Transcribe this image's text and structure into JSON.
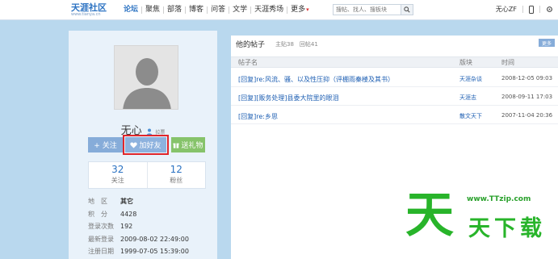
{
  "header": {
    "logo_text": "天涯社区",
    "logo_url": "www.tianya.cn",
    "nav": [
      "论坛",
      "聚焦",
      "部落",
      "博客",
      "问答",
      "文学",
      "天涯秀场",
      "更多"
    ],
    "search_placeholder": "搜帖、找人、搜板块",
    "user_name": "无心ZF"
  },
  "profile": {
    "name": "无心",
    "name_tag": "拉票",
    "buttons": {
      "follow": "+ 关注",
      "add_friend": "加好友",
      "gift": "送礼物"
    },
    "stats": [
      {
        "value": "32",
        "label": "关注"
      },
      {
        "value": "12",
        "label": "粉丝"
      }
    ],
    "info": [
      {
        "key": "地　区",
        "value": "其它"
      },
      {
        "key": "积　分",
        "value": "4428"
      },
      {
        "key": "登录次数",
        "value": "192"
      },
      {
        "key": "最新登录",
        "value": "2009-08-02 22:49:00"
      },
      {
        "key": "注册日期",
        "value": "1999-07-05 15:39:00"
      }
    ]
  },
  "posts": {
    "title": "他的帖子",
    "counts": "主贴38　回帖41",
    "more_label": "更多",
    "columns": [
      "帖子名",
      "版块",
      "时间"
    ],
    "rows": [
      {
        "title": "[回复]re:风流、骚、以及性压抑（评棚雨秦楼及其书）",
        "board": "天涯杂谈",
        "time": "2008-12-05 09:03"
      },
      {
        "title": "[回复][贩务处理]县委大院里的眼泪",
        "board": "天涯志",
        "time": "2008-09-11 17:03"
      },
      {
        "title": "[回复]re:乡思",
        "board": "散文天下",
        "time": "2007-11-04 20:36"
      }
    ]
  },
  "watermark": {
    "big": "天",
    "url": "www.TTzip.com",
    "sub": "天下载"
  },
  "colors": {
    "accent": "#2b72c2",
    "page_bg": "#b9d8ee",
    "highlight_box": "#e0262b",
    "watermark": "#28b42a"
  }
}
